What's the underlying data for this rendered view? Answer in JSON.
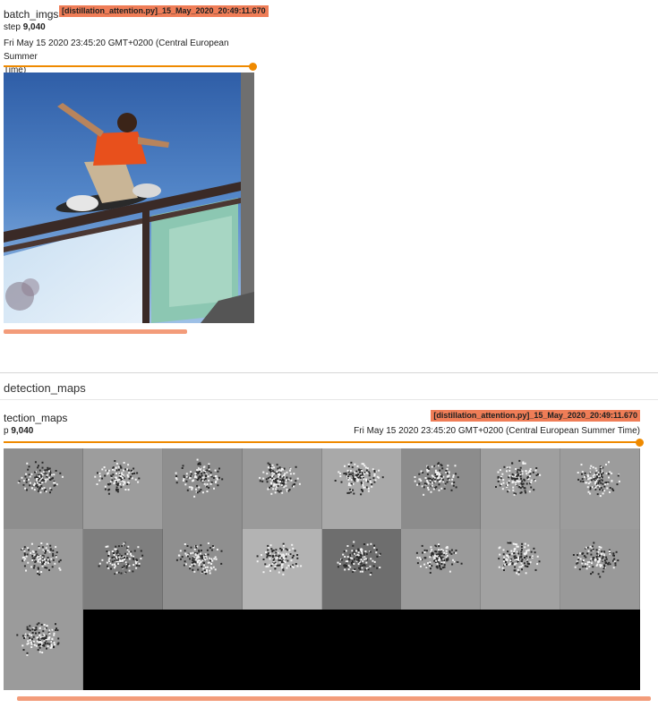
{
  "card1": {
    "title": "batch_imgs",
    "run_tag": "[distillation_attention.py]_15_May_2020_20:49:11.670",
    "step_label": "step",
    "step_value": "9,040",
    "timestamp_line1": "Fri May 15 2020 23:45:20 GMT+0200 (Central European Summer",
    "timestamp_line2": "Time)",
    "slider_fraction": 1.0
  },
  "section": {
    "title": "detection_maps"
  },
  "card2": {
    "title": "tection_maps",
    "run_tag": "[distillation_attention.py]_15_May_2020_20:49:11.670",
    "step_label": "p",
    "step_value": "9,040",
    "timestamp": "Fri May 15 2020 23:45:20 GMT+0200 (Central European Summer Time)",
    "slider_fraction": 1.0,
    "tile_shades": [
      "#8e8e8e",
      "#9d9d9d",
      "#8f8f8f",
      "#9a9a9a",
      "#a9a9a9",
      "#8c8c8c",
      "#9f9f9f",
      "#9c9c9c",
      "#9a9a9a",
      "#7e7e7e",
      "#8f8f8f",
      "#b3b3b3",
      "#6e6e6e",
      "#9a9a9a",
      "#a1a1a1",
      "#999999",
      "#9b9b9b"
    ]
  }
}
